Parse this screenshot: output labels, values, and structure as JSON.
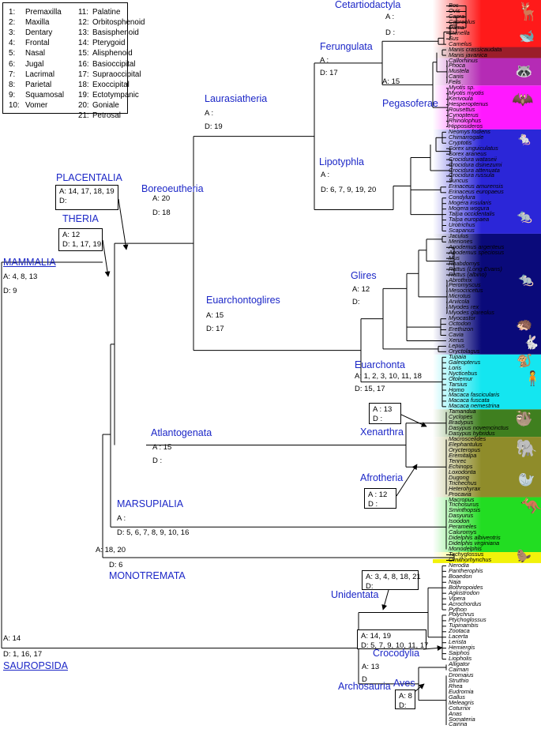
{
  "legend": [
    {
      "n": "1:",
      "name": "Premaxilla"
    },
    {
      "n": "2:",
      "name": "Maxilla"
    },
    {
      "n": "3:",
      "name": "Dentary"
    },
    {
      "n": "4:",
      "name": "Frontal"
    },
    {
      "n": "5:",
      "name": "Nasal"
    },
    {
      "n": "6:",
      "name": "Jugal"
    },
    {
      "n": "7:",
      "name": "Lacrimal"
    },
    {
      "n": "8:",
      "name": "Parietal"
    },
    {
      "n": "9:",
      "name": "Squamosal"
    },
    {
      "n": "10:",
      "name": "Vomer"
    },
    {
      "n": "11:",
      "name": "Palatine"
    },
    {
      "n": "12:",
      "name": "Orbitosphenoid"
    },
    {
      "n": "13:",
      "name": "Basisphenoid"
    },
    {
      "n": "14:",
      "name": "Pterygoid"
    },
    {
      "n": "15:",
      "name": "Alisphenoid"
    },
    {
      "n": "16:",
      "name": "Basioccipital"
    },
    {
      "n": "17:",
      "name": "Supraoccipital"
    },
    {
      "n": "18:",
      "name": "Exoccipital"
    },
    {
      "n": "19:",
      "name": "Ectotympanic"
    },
    {
      "n": "20:",
      "name": "Goniale"
    },
    {
      "n": "21:",
      "name": "Petrosal"
    }
  ],
  "clades": {
    "cetartiodactyla": "Cetartiodactyla",
    "ferungulata": "Ferungulata",
    "pegasoferae": "Pegasoferae",
    "laurasiatheria": "Laurasiatheria",
    "lipotyphla": "Lipotyphla",
    "boreoeutheria": "Boreoeutheria",
    "placentalia": "PLACENTALIA",
    "theria": "THERIA",
    "mammalia": "MAMMALIA",
    "euarchontoglires": "Euarchontoglires",
    "glires": "Glires",
    "euarchonta": "Euarchonta",
    "xenarthra": "Xenarthra",
    "atlantogenata": "Atlantogenata",
    "afrotheria": "Afrotheria",
    "marsupialia": "MARSUPIALIA",
    "monotremata": "MONOTREMATA",
    "unidentata": "Unidentata",
    "crocodylia": "Crocodylia",
    "archosauria": "Archosauria",
    "aves": "Aves",
    "sauropsida": "SAUROPSIDA"
  },
  "annotations": {
    "cet_a": "A :",
    "cet_d": "D :",
    "fer_a": "A :",
    "fer_d": "D: 17",
    "peg_a": "A: 15",
    "lau_a": "A :",
    "lau_d": "D: 19",
    "lip_a": "A :",
    "lip_d": "D: 6, 7, 9, 19, 20",
    "bor_a": "A: 20",
    "bor_d": "D: 18",
    "pla_a": "A: 14, 17, 18, 19",
    "pla_d": "D:",
    "the_a": "A: 12",
    "the_d": "D: 1, 17, 19",
    "mam_a": "A: 4, 8, 13",
    "mam_d": "D: 9",
    "eua_a": "A: 15",
    "eua_d": "D: 17",
    "gli_a": "A: 12",
    "gli_d": "D:",
    "euc_a": "A: 1, 2, 3, 10, 11, 18",
    "euc_d": "D: 15, 17",
    "xen_a": "A : 13",
    "xen_d": "D :",
    "atl_a": "A : 15",
    "atl_d": "D :",
    "afr_a": "A : 12",
    "afr_d": "D :",
    "mar_a": "A :",
    "mar_d": "D: 5, 6, 7, 8, 9, 10, 16",
    "mon_a": "A: 18, 20",
    "mon_d": "D: 6",
    "uni_a": "A: 3, 4, 8, 18, 21",
    "uni_d": "D:",
    "squ_a": "A: 14, 19",
    "squ_d": "D: 5, 7, 9, 10, 11, 17",
    "cro_a": "A: 13",
    "cro_d": "D",
    "ave_a": "A: 8",
    "ave_d": "D:",
    "sau_a": "A: 14",
    "sau_d": "D: 1, 16, 17"
  },
  "species": [
    "Bos",
    "Ovis",
    "Capra",
    "Capreolus",
    "Dama",
    "Stenella",
    "Sus",
    "Camelus",
    "Manis crassicaudata",
    "Manis javanica",
    "Callorhinus",
    "Phoca",
    "Mustela",
    "Canis",
    "Felis",
    "Myotis sp.",
    "Myotis myotis",
    "Kerivoula",
    "Hesperoptenus",
    "Rousettus",
    "Cynopterus",
    "Rhinolophus",
    "Hipposideros",
    "Neomys fodiens",
    "Chimarrogale",
    "Cryptotis",
    "Sorex unguiculatus",
    "Sorex araneus",
    "Crocidura wataseii",
    "Crocidura dsinezumi",
    "Crocidura attenuata",
    "Crocidura russula",
    "Suncus",
    "Erinaceus amurensis",
    "Erinaceus europaeus",
    "Condylura",
    "Mogera insularis",
    "Mogera wogura",
    "Talpa occidentalis",
    "Talpa europaea",
    "Urotrichus",
    "Scapanus",
    "Jaculus",
    "Meriones",
    "Apodemus argenteus",
    "Apodemus speciosus",
    "Mus",
    "Rhabdomys",
    "Rattus (Long-Evans)",
    "Rattus (albino)",
    "Abrothrix",
    "Peromyscus",
    "Mesocricetus",
    "Microtus",
    "Arvicola",
    "Myodes rex",
    "Myodes glareolus",
    "Myocastor",
    "Octodon",
    "Erethizon",
    "Cavia",
    "Xerus",
    "Lepus",
    "Oryctolagus",
    "Tupaia",
    "Galeopterus",
    "Loris",
    "Nycticebus",
    "Otolemur",
    "Tarsius",
    "Homo",
    "Macaca fascicularis",
    "Macaca fuscata",
    "Macaca nemestrina",
    "Tamandua",
    "Cyclopes",
    "Bradypus",
    "Dasypus novemcinctus",
    "Dasypus hybridus",
    "Macroscelides",
    "Elephantulus",
    "Orycteropus",
    "Eremitalpa",
    "Tenrec",
    "Echinops",
    "Loxodonta",
    "Dugong",
    "Trichechus",
    "Heterohyrax",
    "Procavia",
    "Macropus",
    "Trichosurus",
    "Sminthopsis",
    "Dasyurus",
    "Isoodon",
    "Perameles",
    "Caluromys",
    "Didelphis albiventris",
    "Didelphis virginiana",
    "Monodelphis",
    "Tachyglossus",
    "Ornithorhynchus",
    "Nerodia",
    "Pantherophis",
    "Boaedon",
    "Naja",
    "Bothropoides",
    "Agkistrodon",
    "Vipera",
    "Acrochordus",
    "Python",
    "Polychrus",
    "Ptychoglossus",
    "Tupinambis",
    "Zootaca",
    "Lacerta",
    "Lerista",
    "Hemiergis",
    "Saiphos",
    "Liopholis",
    "Alligator",
    "Caiman",
    "Dromaius",
    "Struthio",
    "Rhea",
    "Eudromia",
    "Gallus",
    "Meleagris",
    "Coturnix",
    "Anas",
    "Somateria",
    "Cairina"
  ],
  "icons": [
    "deer-silhouette",
    "whale-silhouette",
    "raccoon-silhouette",
    "bat-silhouette",
    "shrew-silhouette",
    "mole-silhouette",
    "rodent-silhouette",
    "porcupine-silhouette",
    "rabbit-silhouette",
    "lemur-silhouette",
    "primate-silhouette",
    "anteater-silhouette",
    "elephant-silhouette",
    "manatee-silhouette",
    "kangaroo-silhouette",
    "platypus-silhouette"
  ],
  "bands": [
    {
      "from": 0,
      "to": 10,
      "color": "#ff1a1a"
    },
    {
      "from": 8,
      "to": 10,
      "color": "#9b1e2a"
    },
    {
      "from": 10,
      "to": 15,
      "color": "#b52bb5"
    },
    {
      "from": 15,
      "to": 23,
      "color": "#ff19ff"
    },
    {
      "from": 23,
      "to": 42,
      "color": "#2b26d8"
    },
    {
      "from": 42,
      "to": 64,
      "color": "#0a0a7a"
    },
    {
      "from": 64,
      "to": 74,
      "color": "#14e6f0"
    },
    {
      "from": 74,
      "to": 79,
      "color": "#3f7f1f"
    },
    {
      "from": 79,
      "to": 90,
      "color": "#8f8c2a"
    },
    {
      "from": 90,
      "to": 100,
      "color": "#22dd22"
    },
    {
      "from": 100,
      "to": 102,
      "color": "#f2f20a"
    }
  ]
}
